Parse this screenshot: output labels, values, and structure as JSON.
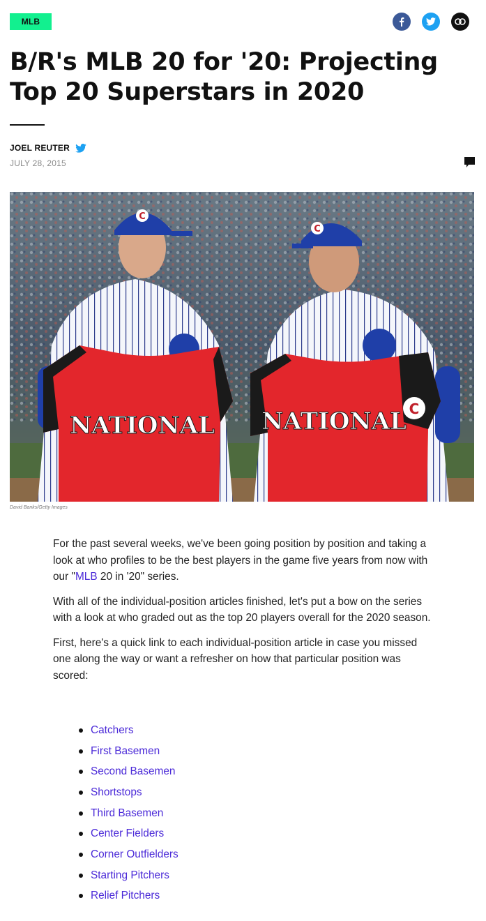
{
  "header": {
    "tag": "MLB",
    "share": [
      {
        "name": "facebook-icon",
        "color": "#3b5998"
      },
      {
        "name": "twitter-icon",
        "color": "#1da1f2"
      },
      {
        "name": "link-icon",
        "color": "#111111"
      }
    ]
  },
  "article": {
    "title": "B/R's MLB 20 for '20: Projecting Top 20 Superstars in 2020",
    "author": "JOEL REUTER",
    "date": "JULY 28, 2015"
  },
  "image": {
    "caption": "David Banks/Getty Images",
    "jersey_text": "NATIONAL"
  },
  "body": {
    "p1_before": "For the past several weeks, we've been going position by position and taking a look at who profiles to be the best players in the game five years from now with our \"",
    "p1_link": "MLB",
    "p1_after": " 20 in '20\" series.",
    "p2": "With all of the individual-position articles finished, let's put a bow on the series with a look at who graded out as the top 20 players overall for the 2020 season.",
    "p3": "First, here's a quick link to each individual-position article in case you missed one along the way or want a refresher on how that particular position was scored:"
  },
  "links": [
    {
      "label": "Catchers"
    },
    {
      "label": "First Basemen"
    },
    {
      "label": "Second Basemen"
    },
    {
      "label": "Shortstops"
    },
    {
      "label": "Third Basemen"
    },
    {
      "label": "Center Fielders"
    },
    {
      "label": "Corner Outfielders"
    },
    {
      "label": "Starting Pitchers"
    },
    {
      "label": "Relief Pitchers"
    }
  ],
  "colors": {
    "tag_bg": "#12f08f",
    "link": "#4b2ad8",
    "cubs_blue": "#1f3fa8",
    "jersey_red": "#e3262c"
  }
}
